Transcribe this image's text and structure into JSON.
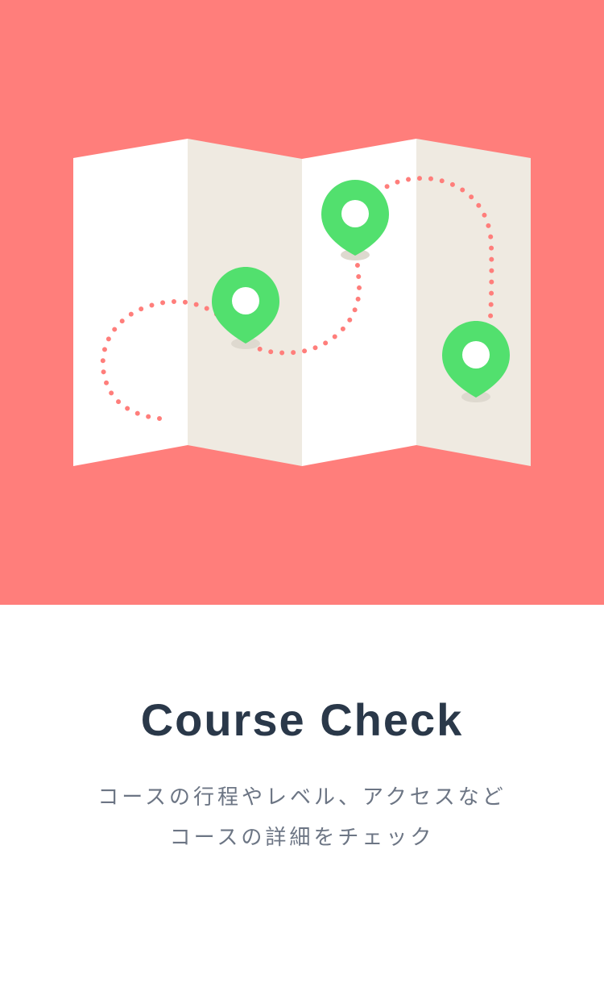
{
  "hero": {
    "background_color": "#FF7E7B",
    "illustration": "folded-map-with-location-pins",
    "pin_color": "#52E06E",
    "route_color": "#FF7E7B",
    "map_panel_colors": [
      "#FFFFFF",
      "#EFEAE1"
    ],
    "pin_count": 3
  },
  "content": {
    "title": "Course Check",
    "description_lines": [
      "コースの行程やレベル、アクセスなど",
      "コースの詳細をチェック"
    ],
    "title_color": "#2A3849",
    "description_color": "#6C7584"
  }
}
